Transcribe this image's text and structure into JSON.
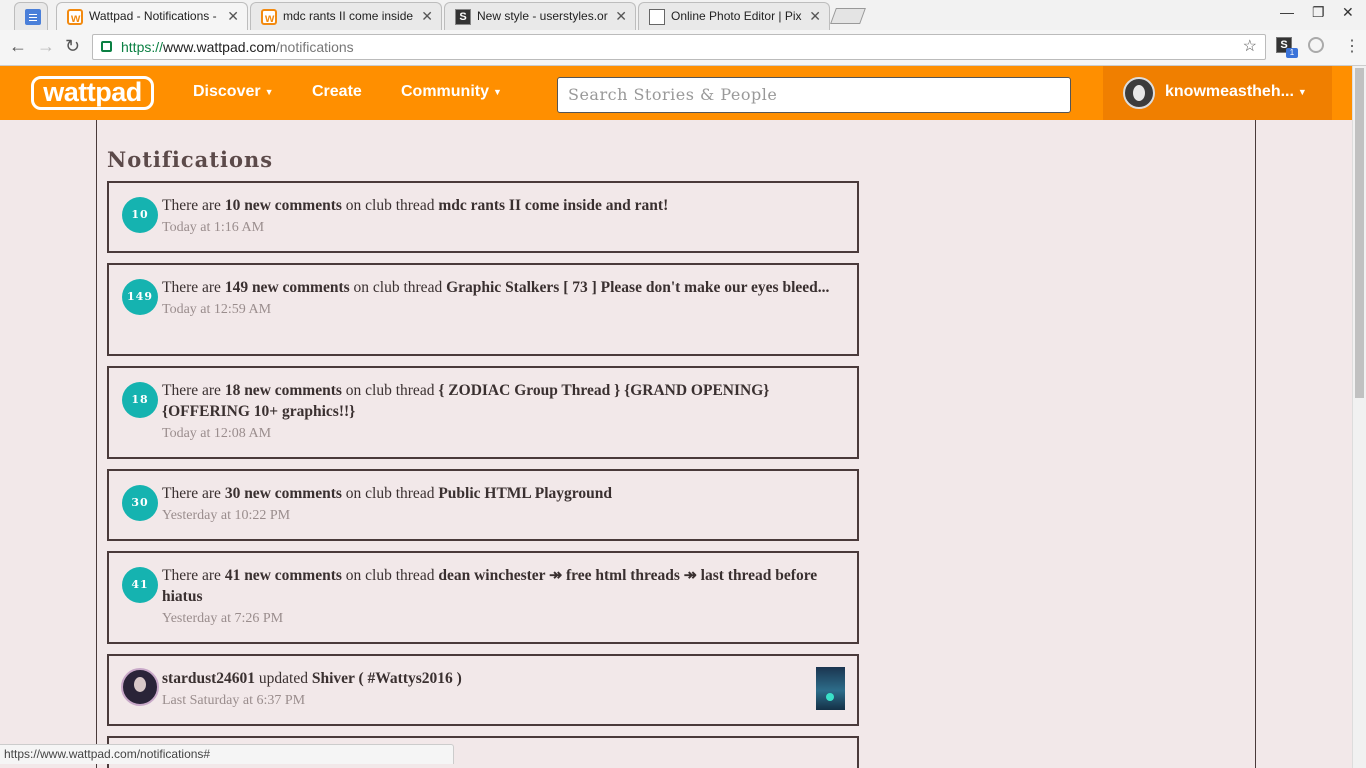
{
  "browser": {
    "tabs": [
      {
        "title": "",
        "icon": "docs-icon"
      },
      {
        "title": "Wattpad - Notifications -",
        "icon": "wattpad-icon",
        "active": true
      },
      {
        "title": "mdc rants II come inside",
        "icon": "wattpad-icon"
      },
      {
        "title": "New style - userstyles.or",
        "icon": "stylish-icon"
      },
      {
        "title": "Online Photo Editor | Pix",
        "icon": "document-icon"
      }
    ],
    "url": {
      "scheme": "https://",
      "host": "www.wattpad.com",
      "path": "/notifications"
    },
    "extension_badge": "1",
    "status_url": "https://www.wattpad.com/notifications#"
  },
  "header": {
    "logo": "wattpad",
    "nav": [
      {
        "label": "Discover",
        "dropdown": true
      },
      {
        "label": "Create",
        "dropdown": false
      },
      {
        "label": "Community",
        "dropdown": true
      }
    ],
    "search_placeholder": "Search Stories & People",
    "username": "knowmeastheh...",
    "accent": "#ff8f00"
  },
  "page": {
    "title": "Notifications",
    "notifications": [
      {
        "count": "10",
        "pre": "There are ",
        "bold1": "10 new comments",
        "mid": " on club thread ",
        "bold2": "mdc rants II come inside and rant!",
        "time": "Today at 1:16 AM"
      },
      {
        "count": "149",
        "pre": "There are ",
        "bold1": "149 new comments",
        "mid": " on club thread ",
        "bold2": "Graphic Stalkers [ 73 ] Please don't make our eyes bleed...",
        "time": "Today at 12:59 AM"
      },
      {
        "count": "18",
        "pre": "There are ",
        "bold1": "18 new comments",
        "mid": " on club thread ",
        "bold2": "{ ZODIAC Group Thread } {GRAND OPENING} {OFFERING 10+ graphics!!}",
        "time": "Today at 12:08 AM"
      },
      {
        "count": "30",
        "pre": "There are ",
        "bold1": "30 new comments",
        "mid": " on club thread ",
        "bold2": "Public HTML Playground",
        "time": "Yesterday at 10:22 PM"
      },
      {
        "count": "41",
        "pre": "There are ",
        "bold1": "41 new comments",
        "mid": " on club thread ",
        "bold2": "dean winchester ↠ free html threads ↠ last thread before hiatus",
        "time": "Yesterday at 7:26 PM"
      }
    ],
    "story_update": {
      "user": "stardust24601",
      "action": " updated ",
      "story": "Shiver ( #Wattys2016 )",
      "time": "Last Saturday at 6:37 PM"
    }
  }
}
